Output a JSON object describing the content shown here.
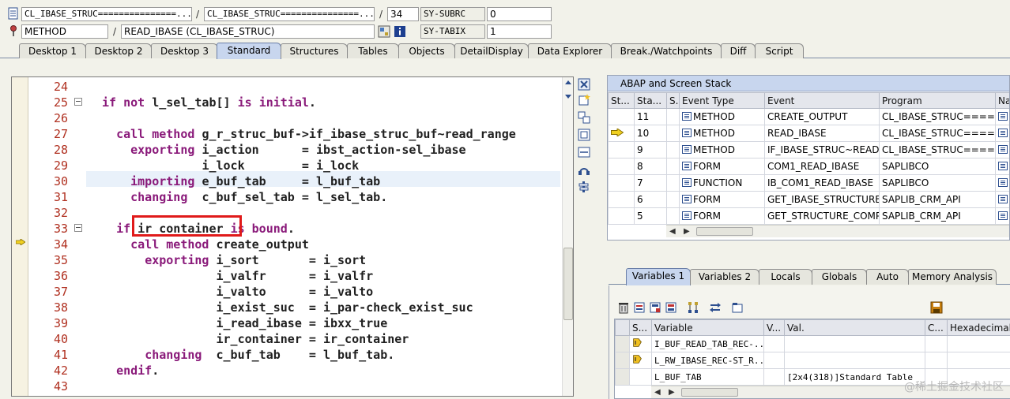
{
  "header": {
    "row1": {
      "program": "CL_IBASE_STRUC===============...",
      "include": "CL_IBASE_STRUC===============...",
      "line": "34",
      "sysfield": "SY-SUBRC",
      "sysvalue": "0"
    },
    "row2": {
      "event_type": "METHOD",
      "event": "READ_IBASE (CL_IBASE_STRUC)",
      "sysfield": "SY-TABIX",
      "sysvalue": "1"
    },
    "separator": "/"
  },
  "tabs": [
    "Desktop 1",
    "Desktop 2",
    "Desktop 3",
    "Standard",
    "Structures",
    "Tables",
    "Objects",
    "DetailDisplay",
    "Data Explorer",
    "Break./Watchpoints",
    "Diff",
    "Script"
  ],
  "active_tab": "Standard",
  "code": {
    "lines": [
      {
        "n": "24",
        "t": ""
      },
      {
        "n": "25",
        "t": "if not l_sel_tab[] is initial."
      },
      {
        "n": "26",
        "t": ""
      },
      {
        "n": "27",
        "t": "  call method g_r_struc_buf->if_ibase_struc_buf~read_range"
      },
      {
        "n": "28",
        "t": "    exporting i_action      = ibst_action-sel_ibase"
      },
      {
        "n": "29",
        "t": "              i_lock        = i_lock"
      },
      {
        "n": "30",
        "t": "    importing e_buf_tab     = l_buf_tab"
      },
      {
        "n": "31",
        "t": "    changing  c_buf_sel_tab = l_sel_tab."
      },
      {
        "n": "32",
        "t": ""
      },
      {
        "n": "33",
        "t": "  if ir_container is bound."
      },
      {
        "n": "34",
        "t": "    call method create_output"
      },
      {
        "n": "35",
        "t": "      exporting i_sort       = i_sort"
      },
      {
        "n": "36",
        "t": "                i_valfr      = i_valfr"
      },
      {
        "n": "37",
        "t": "                i_valto      = i_valto"
      },
      {
        "n": "38",
        "t": "                i_exist_suc  = i_par-check_exist_suc"
      },
      {
        "n": "39",
        "t": "                i_read_ibase = ibxx_true"
      },
      {
        "n": "40",
        "t": "                ir_container = ir_container"
      },
      {
        "n": "41",
        "t": "      changing  c_buf_tab    = l_buf_tab."
      },
      {
        "n": "42",
        "t": "  endif."
      },
      {
        "n": "43",
        "t": ""
      }
    ]
  },
  "stack": {
    "title": "ABAP and Screen Stack",
    "columns": [
      "St...",
      "Sta...",
      "S...",
      "Event Type",
      "Event",
      "Program",
      "Na"
    ],
    "rows": [
      {
        "level": "11",
        "type": "METHOD",
        "event": "CREATE_OUTPUT",
        "program": "CL_IBASE_STRUC====...",
        "current": false
      },
      {
        "level": "10",
        "type": "METHOD",
        "event": "READ_IBASE",
        "program": "CL_IBASE_STRUC====...",
        "current": true
      },
      {
        "level": "9",
        "type": "METHOD",
        "event": "IF_IBASE_STRUC~READ...",
        "program": "CL_IBASE_STRUC====...",
        "current": false
      },
      {
        "level": "8",
        "type": "FORM",
        "event": "COM1_READ_IBASE",
        "program": "SAPLIBCO",
        "current": false
      },
      {
        "level": "7",
        "type": "FUNCTION",
        "event": "IB_COM1_READ_IBASE",
        "program": "SAPLIBCO",
        "current": false
      },
      {
        "level": "6",
        "type": "FORM",
        "event": "GET_IBASE_STRUCTURE",
        "program": "SAPLIB_CRM_API",
        "current": false
      },
      {
        "level": "5",
        "type": "FORM",
        "event": "GET_STRUCTURE_COMP...",
        "program": "SAPLIB_CRM_API",
        "current": false
      }
    ]
  },
  "var_tabs": [
    "Variables 1",
    "Variables 2",
    "Locals",
    "Globals",
    "Auto",
    "Memory Analysis"
  ],
  "active_var_tab": "Variables 1",
  "variables": {
    "columns": [
      "S...",
      "Variable",
      "V...",
      "Val.",
      "C...",
      "Hexadecimal V"
    ],
    "rows": [
      {
        "name": "I_BUF_READ_TAB_REC-...",
        "value": ""
      },
      {
        "name": "L_RW_IBASE_REC-ST_R...",
        "value": ""
      },
      {
        "name": "L_BUF_TAB",
        "value": "[2x4(318)]Standard Table"
      }
    ]
  },
  "watermark": "@稀土掘金技术社区",
  "colors": {
    "keyword": "#8a1a7a",
    "linenum": "#b03020",
    "active_tab": "#c8d6ee",
    "highlight": "#e01a1a"
  }
}
